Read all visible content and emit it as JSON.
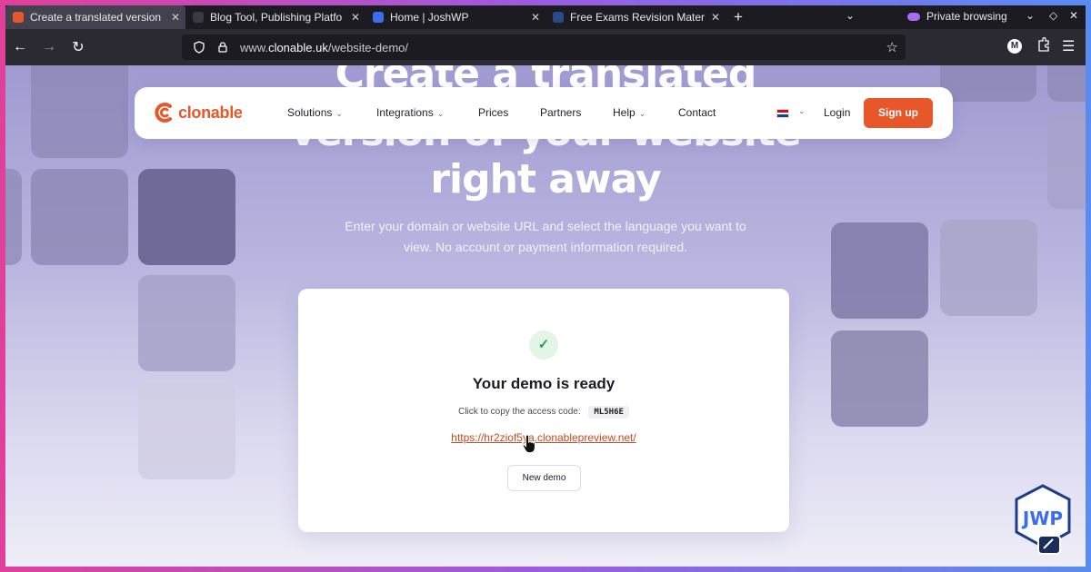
{
  "browser": {
    "tabs": [
      {
        "title": "Create a translated version",
        "active": true,
        "favicon_color": "#e8572a"
      },
      {
        "title": "Blog Tool, Publishing Platfo",
        "active": false,
        "favicon_color": "#3a3a44"
      },
      {
        "title": "Home | JoshWP",
        "active": false,
        "favicon_color": "#3c6df0"
      },
      {
        "title": "Free Exams Revision Mater",
        "active": false,
        "favicon_color": "#2b4a8a"
      }
    ],
    "new_tab_label": "+",
    "private_label": "Private browsing",
    "url_prefix": "www.",
    "url_domain": "clonable.uk",
    "url_path": "/website-demo/"
  },
  "site": {
    "logo_text": "clonable",
    "brand_color": "#e8572a",
    "nav": [
      {
        "label": "Solutions",
        "dropdown": true
      },
      {
        "label": "Integrations",
        "dropdown": true
      },
      {
        "label": "Prices",
        "dropdown": false
      },
      {
        "label": "Partners",
        "dropdown": false
      },
      {
        "label": "Help",
        "dropdown": true
      },
      {
        "label": "Contact",
        "dropdown": false
      }
    ],
    "login_label": "Login",
    "signup_label": "Sign up"
  },
  "hero": {
    "title_line1": "Create a translated",
    "title_line2": "version of your website",
    "title_line3": "right away",
    "subtitle_line1": "Enter your domain or website URL and select the language you want to",
    "subtitle_line2": "view. No account or payment information required."
  },
  "card": {
    "title": "Your demo is ready",
    "copy_prompt": "Click to copy the access code:",
    "access_code": "ML5H6E",
    "demo_url": "https://hr2ziof5ya.clonablepreview.net/",
    "new_demo_label": "New demo"
  }
}
